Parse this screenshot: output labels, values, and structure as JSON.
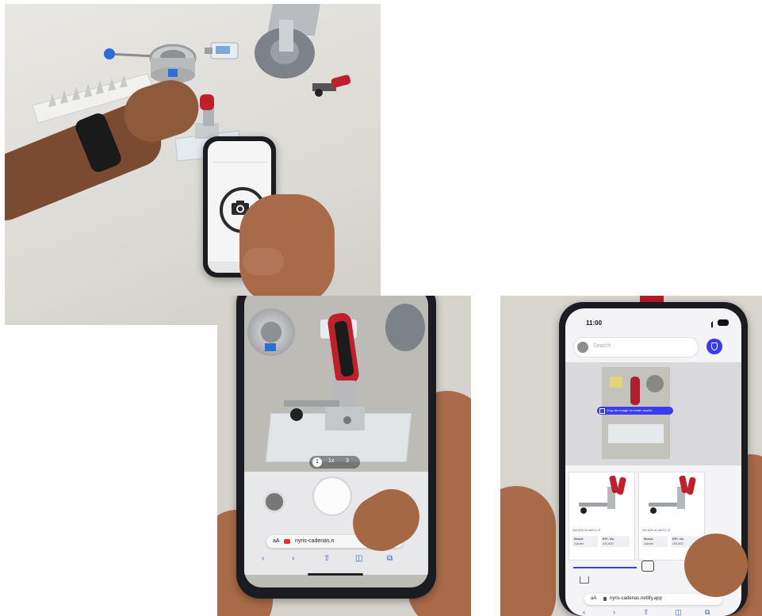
{
  "photo2": {
    "url_text": "aA",
    "url_domain": "nyris-cadenas.n",
    "zoom_options": [
      "1",
      "1x",
      "3"
    ]
  },
  "photo3": {
    "status_time": "11:00",
    "search_placeholder": "Search",
    "crop_tip": "Crop the image for better results",
    "results": [
      {
        "title": "GN 820-30-MS-C-S",
        "tag1": "Brand",
        "tag1_sub": "Ganter",
        "tag2": "EPL No",
        "tag2_sub": "GN 820"
      },
      {
        "title": "GN 820-40-MS-C-S",
        "tag1": "Brand",
        "tag1_sub": "Ganter",
        "tag2": "EPL No",
        "tag2_sub": "GN 820"
      }
    ],
    "url_text": "aA",
    "url_domain": "nyris-cadenas.netlify.app"
  },
  "colors": {
    "accent": "#3a3cf0",
    "handle_red": "#c0202c",
    "phone_body": "#1a1c22"
  }
}
